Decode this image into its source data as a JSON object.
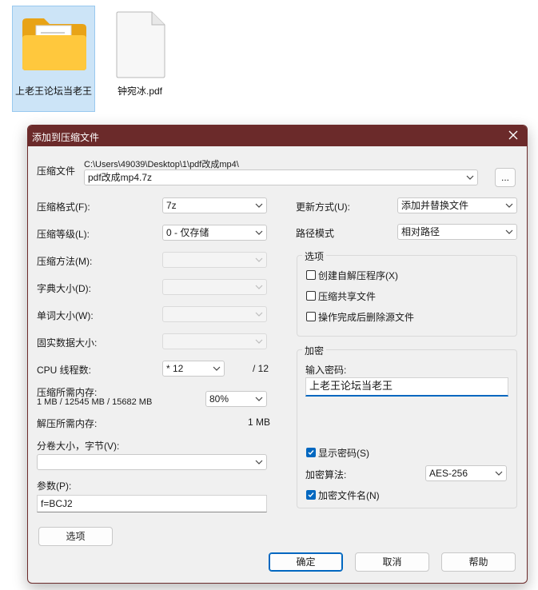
{
  "desktop": {
    "folder": {
      "label": "上老王论坛当老王"
    },
    "pdf": {
      "label": "钟宛冰.pdf"
    }
  },
  "dialog": {
    "title": "添加到压缩文件",
    "archive": {
      "label": "压缩文件",
      "path": "C:\\Users\\49039\\Desktop\\1\\pdf改成mp4\\",
      "name": "pdf改成mp4.7z",
      "browse_label": "..."
    },
    "left": {
      "format": {
        "label": "压缩格式(F):",
        "value": "7z"
      },
      "level": {
        "label": "压缩等级(L):",
        "value": "0 - 仅存储"
      },
      "method": {
        "label": "压缩方法(M):"
      },
      "dict": {
        "label": "字典大小(D):"
      },
      "word": {
        "label": "单词大小(W):"
      },
      "solid": {
        "label": "固实数据大小:"
      },
      "threads": {
        "label": "CPU 线程数:",
        "value": "* 12",
        "max": "/ 12"
      },
      "mem_compress": {
        "label": "压缩所需内存:",
        "detail": "1 MB / 12545 MB / 15682 MB",
        "value": "80%"
      },
      "mem_decompress": {
        "label": "解压所需内存:",
        "value": "1 MB"
      },
      "volume": {
        "label": "分卷大小，字节(V):",
        "value": ""
      },
      "params": {
        "label": "参数(P):",
        "value": "f=BCJ2"
      },
      "options_button": "选项"
    },
    "right": {
      "update": {
        "label": "更新方式(U):",
        "value": "添加并替换文件"
      },
      "path_mode": {
        "label": "路径模式",
        "value": "相对路径"
      },
      "options_group": {
        "title": "选项",
        "sfx": {
          "label": "创建自解压程序(X)",
          "checked": false
        },
        "shared": {
          "label": "压缩共享文件",
          "checked": false
        },
        "delete": {
          "label": "操作完成后删除源文件",
          "checked": false
        }
      },
      "encryption": {
        "title": "加密",
        "password_label": "输入密码:",
        "password_value": "上老王论坛当老王",
        "show_password": {
          "label": "显示密码(S)",
          "checked": true
        },
        "method_label": "加密算法:",
        "method_value": "AES-256",
        "encrypt_names": {
          "label": "加密文件名(N)",
          "checked": true
        }
      }
    },
    "buttons": {
      "ok": "确定",
      "cancel": "取消",
      "help": "帮助"
    },
    "colors": {
      "title_bar": "#6b2a2a",
      "accent": "#0067c0"
    }
  }
}
